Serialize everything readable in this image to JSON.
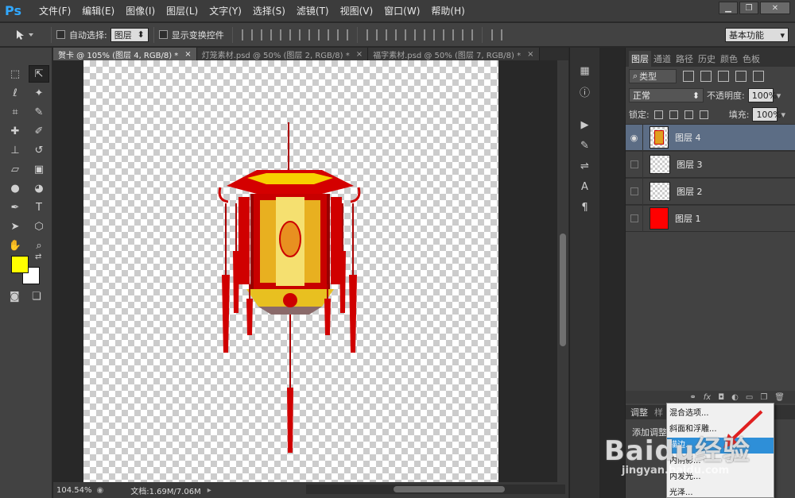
{
  "app": {
    "logo": "Ps",
    "menu": [
      "文件(F)",
      "编辑(E)",
      "图像(I)",
      "图层(L)",
      "文字(Y)",
      "选择(S)",
      "滤镜(T)",
      "视图(V)",
      "窗口(W)",
      "帮助(H)"
    ],
    "window_controls": {
      "minimize": "▁",
      "restore": "❐",
      "close": "✕"
    }
  },
  "options": {
    "tool_icon": "move-tool-icon",
    "auto_select_label": "自动选择:",
    "auto_select_value": "图层",
    "show_transform_label": "显示变换控件",
    "workspace_value": "基本功能"
  },
  "tabs": [
    {
      "label": "贺卡 @ 105% (图层 4, RGB/8) *",
      "close": "×",
      "active": true
    },
    {
      "label": "灯笼素材.psd @ 50% (图层 2, RGB/8) *",
      "close": "×",
      "active": false
    },
    {
      "label": "福字素材.psd @ 50% (图层 7, RGB/8) *",
      "close": "×",
      "active": false
    }
  ],
  "status": {
    "zoom": "104.54%",
    "doc_info": "文档:1.69M/7.06M"
  },
  "colors": {
    "foreground": "#ffff00",
    "background": "#ffffff"
  },
  "layers_panel": {
    "tabs": [
      "图层",
      "通道",
      "路径",
      "历史",
      "颜色",
      "色板"
    ],
    "filter_label": "类型",
    "blend_mode": "正常",
    "opacity_label": "不透明度:",
    "opacity_value": "100%",
    "lock_label": "锁定:",
    "fill_label": "填充:",
    "fill_value": "100%",
    "layers": [
      {
        "name": "图层 4",
        "visible": true,
        "selected": true
      },
      {
        "name": "图层 3",
        "visible": false,
        "selected": false
      },
      {
        "name": "图层 2",
        "visible": false,
        "selected": false
      },
      {
        "name": "图层 1",
        "visible": false,
        "selected": false
      }
    ],
    "bottom_fx": "fx"
  },
  "adjust_panel": {
    "tabs": [
      "调整",
      "样"
    ],
    "body_text": "添加调整"
  },
  "fx_menu": {
    "items": [
      "混合选项...",
      "斜面和浮雕...",
      "描边...",
      "内阴影...",
      "内发光...",
      "光泽..."
    ],
    "highlighted_index": 2
  },
  "watermark": {
    "big": "Baidu经验",
    "small": "jingyan.baidu.com"
  }
}
